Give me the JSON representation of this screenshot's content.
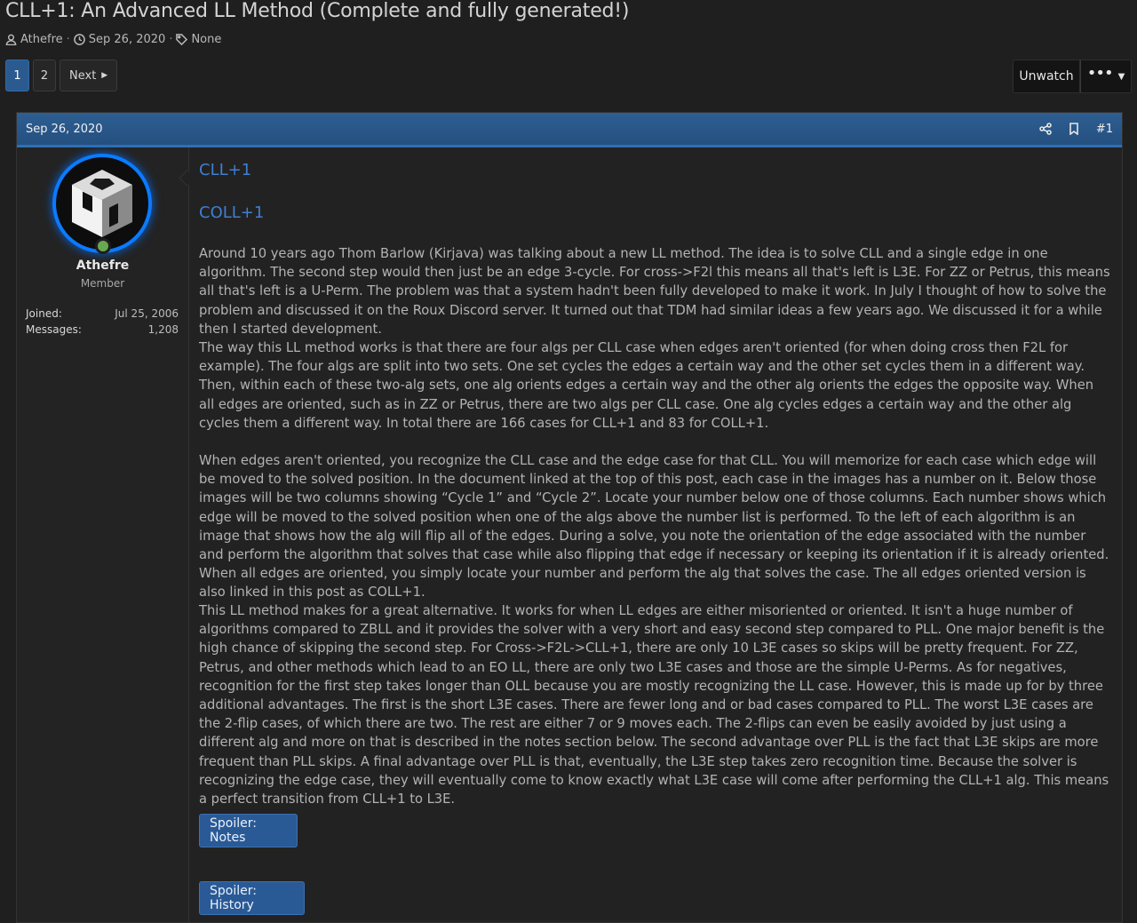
{
  "thread": {
    "title": "CLL+1: An Advanced LL Method (Complete and fully generated!)",
    "author": "Athefre",
    "date": "Sep 26, 2020",
    "tags": "None"
  },
  "pager": {
    "pages": [
      "1",
      "2"
    ],
    "current": "1",
    "next_label": "Next"
  },
  "actions": {
    "unwatch_label": "Unwatch",
    "more_icon": "ellipsis-icon"
  },
  "post": {
    "date": "Sep 26, 2020",
    "number": "#1",
    "icons": [
      "share-icon",
      "bookmark-icon"
    ],
    "user": {
      "name": "Athefre",
      "title": "Member",
      "joined_label": "Joined:",
      "joined": "Jul 25, 2006",
      "messages_label": "Messages:",
      "messages": "1,208",
      "status_color": "#6aa84f"
    },
    "links": {
      "cll1": "CLL+1",
      "coll1": "COLL+1"
    },
    "paragraphs": [
      "Around 10 years ago Thom Barlow (Kirjava) was talking about a new LL method. The idea is to solve CLL and a single edge in one algorithm. The second step would then just be an edge 3-cycle. For cross->F2l this means all that's left is L3E. For ZZ or Petrus, this means all that's left is a U-Perm. The problem was that a system hadn't been fully developed to make it work. In July I thought of how to solve the problem and discussed it on the Roux Discord server. It turned out that TDM had similar ideas a few years ago. We discussed it for a while then I started development.",
      "The way this LL method works is that there are four algs per CLL case when edges aren't oriented (for when doing cross then F2L for example). The four algs are split into two sets. One set cycles the edges a certain way and the other set cycles them in a different way. Then, within each of these two-alg sets, one alg orients edges a certain way and the other alg orients the edges the opposite way. When all edges are oriented, such as in ZZ or Petrus, there are two algs per CLL case. One alg cycles edges a certain way and the other alg cycles them a different way. In total there are 166 cases for CLL+1 and 83 for COLL+1.",
      "When edges aren't oriented, you recognize the CLL case and the edge case for that CLL. You will memorize for each case which edge will be moved to the solved position. In the document linked at the top of this post, each case in the images has a number on it. Below those images will be two columns showing “Cycle 1” and “Cycle 2”. Locate your number below one of those columns. Each number shows which edge will be moved to the solved position when one of the algs above the number list is performed. To the left of each algorithm is an image that shows how the alg will flip all of the edges. During a solve, you note the orientation of the edge associated with the number and perform the algorithm that solves that case while also flipping that edge if necessary or keeping its orientation if it is already oriented. When all edges are oriented, you simply locate your number and perform the alg that solves the case. The all edges oriented version is also linked in this post as COLL+1.",
      "This LL method makes for a great alternative. It works for when LL edges are either misoriented or oriented. It isn't a huge number of algorithms compared to ZBLL and it provides the solver with a very short and easy second step compared to PLL. One major benefit is the high chance of skipping the second step. For Cross->F2L->CLL+1, there are only 10 L3E cases so skips will be pretty frequent. For ZZ, Petrus, and other methods which lead to an EO LL, there are only two L3E cases and those are the simple U-Perms. As for negatives, recognition for the first step takes longer than OLL because you are mostly recognizing the LL case. However, this is made up for by three additional advantages. The first is the short L3E cases. There are fewer long and or bad cases compared to PLL. The worst L3E cases are the 2-flip cases, of which there are two. The rest are either 7 or 9 moves each. The 2-flips can even be easily avoided by just using a different alg and more on that is described in the notes section below. The second advantage over PLL is the fact that L3E skips are more frequent than PLL skips. A final advantage over PLL is that, eventually, the L3E step takes zero recognition time. Because the solver is recognizing the edge case, they will eventually come to know exactly what L3E case will come after performing the CLL+1 alg. This means a perfect transition from CLL+1 to L3E."
    ],
    "spoilers": [
      "Spoiler: Notes",
      "Spoiler: History"
    ]
  }
}
